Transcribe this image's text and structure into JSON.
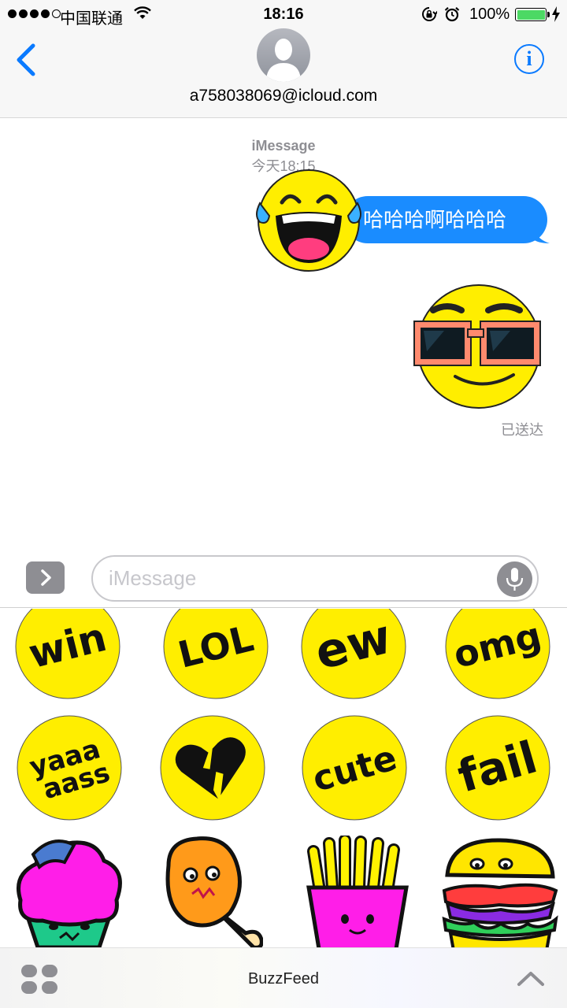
{
  "status_bar": {
    "carrier": "中国联通",
    "time": "18:16",
    "battery_percent": "100%",
    "battery_level": 1.0,
    "signal_bars_filled": 4,
    "signal_bars_total": 5
  },
  "header": {
    "contact": "a758038069@icloud.com",
    "back_icon": "chevron-left-icon",
    "info_icon": "info-icon",
    "avatar_icon": "person-silhouette-icon"
  },
  "conversation": {
    "service_label": "iMessage",
    "timestamp": "今天18:15",
    "messages": [
      {
        "type": "text",
        "text": "哈哈哈啊哈哈哈"
      }
    ],
    "stickers_sent": [
      "laughing-tears-emoji",
      "sunglasses-emoji"
    ],
    "delivery_status": "已送达"
  },
  "composer": {
    "placeholder": "iMessage",
    "value": "",
    "expand_icon": "chevron-right-icon",
    "mic_icon": "microphone-icon"
  },
  "sticker_drawer": {
    "word_stickers": [
      "win",
      "LOL",
      "ew",
      "omg",
      "yaaa aass",
      "",
      "cute",
      "fail"
    ],
    "food_stickers": [
      "cupcake",
      "fried-chicken",
      "french-fries",
      "sandwich"
    ]
  },
  "app_bar": {
    "app_name": "BuzzFeed",
    "apps_icon": "app-grid-icon",
    "collapse_icon": "chevron-up-icon"
  },
  "colors": {
    "accent_blue": "#0a7aff",
    "bubble_blue": "#1a8cff",
    "sticker_yellow": "#ffee00",
    "battery_green": "#4cd964",
    "secondary_gray": "#8e8e93"
  }
}
